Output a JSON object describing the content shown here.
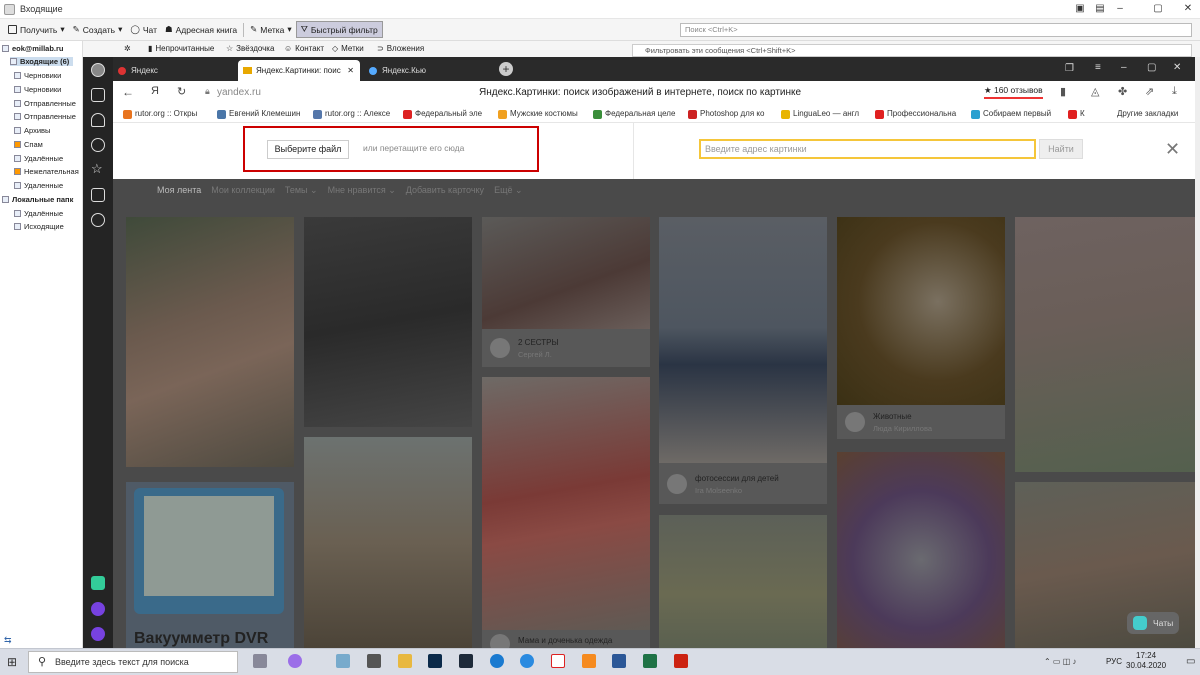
{
  "thunderbird": {
    "window_title": "Входящие",
    "toolbar": {
      "get": "Получить",
      "create": "Создать",
      "chat": "Чат",
      "address_book": "Адресная книга",
      "tag": "Метка",
      "quick_filter": "Быстрый фильтр"
    },
    "search_placeholder": "Поиск <Ctrl+K>",
    "filter_bar": {
      "unread": "Непрочитанные",
      "starred": "Звёздочка",
      "contact": "Контакт",
      "tags": "Метки",
      "attachments": "Вложения",
      "filter_placeholder": "Фильтровать эти сообщения <Ctrl+Shift+K>"
    },
    "folders": [
      {
        "label": "eok@millab.ru",
        "bold": true
      },
      {
        "label": "Входящие (6)",
        "bold": true,
        "selected": true
      },
      {
        "label": "Черновики"
      },
      {
        "label": "Черновики"
      },
      {
        "label": "Отправленные"
      },
      {
        "label": "Отправленные"
      },
      {
        "label": "Архивы"
      },
      {
        "label": "Спам"
      },
      {
        "label": "Удалённые"
      },
      {
        "label": "Нежелательная"
      },
      {
        "label": "Удаленные"
      },
      {
        "label": "Локальные папк",
        "bold": true
      },
      {
        "label": "Удалённые"
      },
      {
        "label": "Исходящие"
      }
    ]
  },
  "browser": {
    "tabs": [
      {
        "label": "Яндекс"
      },
      {
        "label": "Яндекс.Картинки: поис",
        "active": true
      },
      {
        "label": "Яндекс.Кью"
      }
    ],
    "address": "yandex.ru",
    "page_title": "Яндекс.Картинки: поиск изображений в интернете, поиск по картинке",
    "reviews": "★ 160 отзывов",
    "bookmarks": [
      {
        "label": "rutor.org :: Откры",
        "color": "#e8741e"
      },
      {
        "label": "Евгений Клемешин",
        "color": "#4a76a8"
      },
      {
        "label": "rutor.org :: Алексе",
        "color": "#5577aa"
      },
      {
        "label": "Федеральный эле",
        "color": "#d22"
      },
      {
        "label": "Мужские костюмы",
        "color": "#f0a020"
      },
      {
        "label": "Федеральная целе",
        "color": "#3a8e3a"
      },
      {
        "label": "Photoshop для ко",
        "color": "#cc2222"
      },
      {
        "label": "LinguaLeo — англ",
        "color": "#e8b400"
      },
      {
        "label": "Профессиональна",
        "color": "#e02020"
      },
      {
        "label": "Собираем первый",
        "color": "#2aa0d0"
      },
      {
        "label": "К",
        "color": "#e02020"
      }
    ],
    "other_bookmarks": "Другие закладки",
    "upload": {
      "choose_file": "Выберите файл",
      "drag_hint": "или перетащите его сюда",
      "url_placeholder": "Введите адрес картинки",
      "find_button": "Найти"
    },
    "feed_nav": [
      "Моя лента",
      "Мои коллекции",
      "Темы ⌄",
      "Мне нравится ⌄",
      "Добавить карточку",
      "Ещё ⌄"
    ],
    "cards": [
      {
        "title": "2 СЕСТРЫ",
        "author": "Сергей Л."
      },
      {
        "title": "Животные",
        "author": "Люда Кириллова"
      },
      {
        "title": "фотосессии для детей",
        "author": "Ira Molseenko"
      },
      {
        "title": "Мама и доченька одежда",
        "author": ""
      },
      {
        "title": "Вакуумметр DVR",
        "author": ""
      }
    ],
    "chats": "Чаты"
  },
  "taskbar": {
    "search_placeholder": "Введите здесь текст для поиска",
    "lang": "РУС",
    "time": "17:24",
    "date": "30.04.2020"
  }
}
